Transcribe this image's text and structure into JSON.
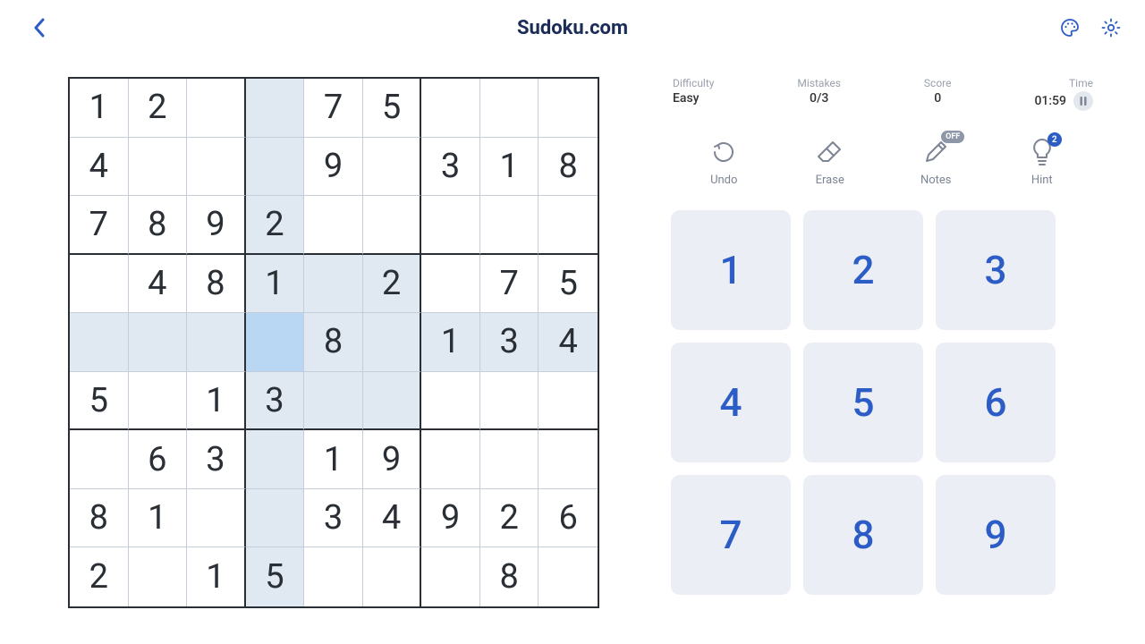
{
  "header": {
    "title": "Sudoku.com"
  },
  "stats": {
    "difficulty_label": "Difficulty",
    "difficulty_value": "Easy",
    "mistakes_label": "Mistakes",
    "mistakes_value": "0/3",
    "score_label": "Score",
    "score_value": "0",
    "time_label": "Time",
    "time_value": "01:59"
  },
  "actions": {
    "undo": "Undo",
    "erase": "Erase",
    "notes": "Notes",
    "notes_badge": "OFF",
    "hint": "Hint",
    "hint_badge": "2"
  },
  "numpad": [
    "1",
    "2",
    "3",
    "4",
    "5",
    "6",
    "7",
    "8",
    "9"
  ],
  "board": {
    "selected": [
      4,
      3
    ],
    "grid": [
      [
        "1",
        "2",
        "",
        "",
        "7",
        "5",
        "",
        "",
        ""
      ],
      [
        "4",
        "",
        "",
        "",
        "9",
        "",
        "3",
        "1",
        "8"
      ],
      [
        "7",
        "8",
        "9",
        "2",
        "",
        "",
        "",
        "",
        ""
      ],
      [
        "",
        "4",
        "8",
        "1",
        "",
        "2",
        "",
        "7",
        "5"
      ],
      [
        "",
        "",
        "",
        "",
        "8",
        "",
        "1",
        "3",
        "4"
      ],
      [
        "5",
        "",
        "1",
        "3",
        "",
        "",
        "",
        "",
        ""
      ],
      [
        "",
        "6",
        "3",
        "",
        "1",
        "9",
        "",
        "",
        ""
      ],
      [
        "8",
        "1",
        "",
        "",
        "3",
        "4",
        "9",
        "2",
        "6"
      ],
      [
        "2",
        "",
        "1",
        "5",
        "",
        "",
        "",
        "8",
        ""
      ]
    ]
  },
  "colors": {
    "accent": "#2c5cc5",
    "cell_highlight": "#e0e8f1",
    "cell_selected": "#b9d6f2",
    "pad_bg": "#ebeff5"
  }
}
